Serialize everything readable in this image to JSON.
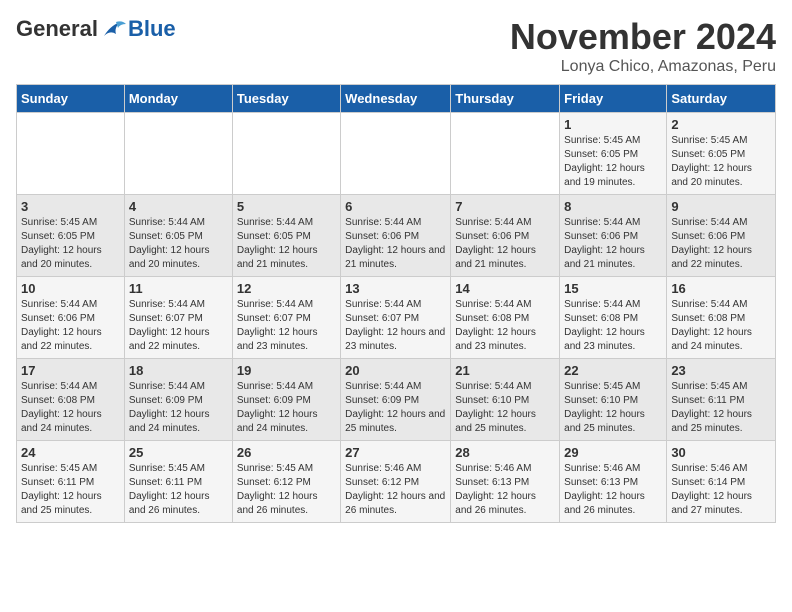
{
  "logo": {
    "general": "General",
    "blue": "Blue"
  },
  "title": "November 2024",
  "location": "Lonya Chico, Amazonas, Peru",
  "weekdays": [
    "Sunday",
    "Monday",
    "Tuesday",
    "Wednesday",
    "Thursday",
    "Friday",
    "Saturday"
  ],
  "weeks": [
    [
      {
        "day": "",
        "info": ""
      },
      {
        "day": "",
        "info": ""
      },
      {
        "day": "",
        "info": ""
      },
      {
        "day": "",
        "info": ""
      },
      {
        "day": "",
        "info": ""
      },
      {
        "day": "1",
        "info": "Sunrise: 5:45 AM\nSunset: 6:05 PM\nDaylight: 12 hours and 19 minutes."
      },
      {
        "day": "2",
        "info": "Sunrise: 5:45 AM\nSunset: 6:05 PM\nDaylight: 12 hours and 20 minutes."
      }
    ],
    [
      {
        "day": "3",
        "info": "Sunrise: 5:45 AM\nSunset: 6:05 PM\nDaylight: 12 hours and 20 minutes."
      },
      {
        "day": "4",
        "info": "Sunrise: 5:44 AM\nSunset: 6:05 PM\nDaylight: 12 hours and 20 minutes."
      },
      {
        "day": "5",
        "info": "Sunrise: 5:44 AM\nSunset: 6:05 PM\nDaylight: 12 hours and 21 minutes."
      },
      {
        "day": "6",
        "info": "Sunrise: 5:44 AM\nSunset: 6:06 PM\nDaylight: 12 hours and 21 minutes."
      },
      {
        "day": "7",
        "info": "Sunrise: 5:44 AM\nSunset: 6:06 PM\nDaylight: 12 hours and 21 minutes."
      },
      {
        "day": "8",
        "info": "Sunrise: 5:44 AM\nSunset: 6:06 PM\nDaylight: 12 hours and 21 minutes."
      },
      {
        "day": "9",
        "info": "Sunrise: 5:44 AM\nSunset: 6:06 PM\nDaylight: 12 hours and 22 minutes."
      }
    ],
    [
      {
        "day": "10",
        "info": "Sunrise: 5:44 AM\nSunset: 6:06 PM\nDaylight: 12 hours and 22 minutes."
      },
      {
        "day": "11",
        "info": "Sunrise: 5:44 AM\nSunset: 6:07 PM\nDaylight: 12 hours and 22 minutes."
      },
      {
        "day": "12",
        "info": "Sunrise: 5:44 AM\nSunset: 6:07 PM\nDaylight: 12 hours and 23 minutes."
      },
      {
        "day": "13",
        "info": "Sunrise: 5:44 AM\nSunset: 6:07 PM\nDaylight: 12 hours and 23 minutes."
      },
      {
        "day": "14",
        "info": "Sunrise: 5:44 AM\nSunset: 6:08 PM\nDaylight: 12 hours and 23 minutes."
      },
      {
        "day": "15",
        "info": "Sunrise: 5:44 AM\nSunset: 6:08 PM\nDaylight: 12 hours and 23 minutes."
      },
      {
        "day": "16",
        "info": "Sunrise: 5:44 AM\nSunset: 6:08 PM\nDaylight: 12 hours and 24 minutes."
      }
    ],
    [
      {
        "day": "17",
        "info": "Sunrise: 5:44 AM\nSunset: 6:08 PM\nDaylight: 12 hours and 24 minutes."
      },
      {
        "day": "18",
        "info": "Sunrise: 5:44 AM\nSunset: 6:09 PM\nDaylight: 12 hours and 24 minutes."
      },
      {
        "day": "19",
        "info": "Sunrise: 5:44 AM\nSunset: 6:09 PM\nDaylight: 12 hours and 24 minutes."
      },
      {
        "day": "20",
        "info": "Sunrise: 5:44 AM\nSunset: 6:09 PM\nDaylight: 12 hours and 25 minutes."
      },
      {
        "day": "21",
        "info": "Sunrise: 5:44 AM\nSunset: 6:10 PM\nDaylight: 12 hours and 25 minutes."
      },
      {
        "day": "22",
        "info": "Sunrise: 5:45 AM\nSunset: 6:10 PM\nDaylight: 12 hours and 25 minutes."
      },
      {
        "day": "23",
        "info": "Sunrise: 5:45 AM\nSunset: 6:11 PM\nDaylight: 12 hours and 25 minutes."
      }
    ],
    [
      {
        "day": "24",
        "info": "Sunrise: 5:45 AM\nSunset: 6:11 PM\nDaylight: 12 hours and 25 minutes."
      },
      {
        "day": "25",
        "info": "Sunrise: 5:45 AM\nSunset: 6:11 PM\nDaylight: 12 hours and 26 minutes."
      },
      {
        "day": "26",
        "info": "Sunrise: 5:45 AM\nSunset: 6:12 PM\nDaylight: 12 hours and 26 minutes."
      },
      {
        "day": "27",
        "info": "Sunrise: 5:46 AM\nSunset: 6:12 PM\nDaylight: 12 hours and 26 minutes."
      },
      {
        "day": "28",
        "info": "Sunrise: 5:46 AM\nSunset: 6:13 PM\nDaylight: 12 hours and 26 minutes."
      },
      {
        "day": "29",
        "info": "Sunrise: 5:46 AM\nSunset: 6:13 PM\nDaylight: 12 hours and 26 minutes."
      },
      {
        "day": "30",
        "info": "Sunrise: 5:46 AM\nSunset: 6:14 PM\nDaylight: 12 hours and 27 minutes."
      }
    ]
  ]
}
